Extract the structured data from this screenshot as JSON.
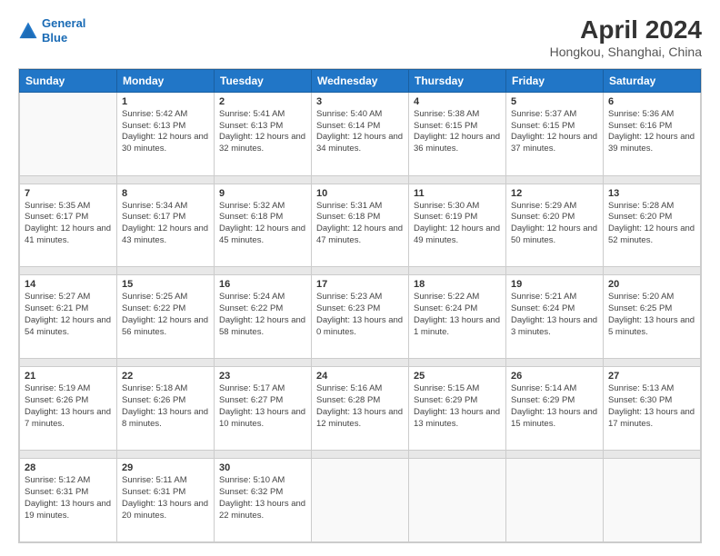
{
  "logo": {
    "line1": "General",
    "line2": "Blue"
  },
  "title": "April 2024",
  "subtitle": "Hongkou, Shanghai, China",
  "days_of_week": [
    "Sunday",
    "Monday",
    "Tuesday",
    "Wednesday",
    "Thursday",
    "Friday",
    "Saturday"
  ],
  "weeks": [
    [
      {
        "num": "",
        "sunrise": "",
        "sunset": "",
        "daylight": ""
      },
      {
        "num": "1",
        "sunrise": "Sunrise: 5:42 AM",
        "sunset": "Sunset: 6:13 PM",
        "daylight": "Daylight: 12 hours and 30 minutes."
      },
      {
        "num": "2",
        "sunrise": "Sunrise: 5:41 AM",
        "sunset": "Sunset: 6:13 PM",
        "daylight": "Daylight: 12 hours and 32 minutes."
      },
      {
        "num": "3",
        "sunrise": "Sunrise: 5:40 AM",
        "sunset": "Sunset: 6:14 PM",
        "daylight": "Daylight: 12 hours and 34 minutes."
      },
      {
        "num": "4",
        "sunrise": "Sunrise: 5:38 AM",
        "sunset": "Sunset: 6:15 PM",
        "daylight": "Daylight: 12 hours and 36 minutes."
      },
      {
        "num": "5",
        "sunrise": "Sunrise: 5:37 AM",
        "sunset": "Sunset: 6:15 PM",
        "daylight": "Daylight: 12 hours and 37 minutes."
      },
      {
        "num": "6",
        "sunrise": "Sunrise: 5:36 AM",
        "sunset": "Sunset: 6:16 PM",
        "daylight": "Daylight: 12 hours and 39 minutes."
      }
    ],
    [
      {
        "num": "7",
        "sunrise": "Sunrise: 5:35 AM",
        "sunset": "Sunset: 6:17 PM",
        "daylight": "Daylight: 12 hours and 41 minutes."
      },
      {
        "num": "8",
        "sunrise": "Sunrise: 5:34 AM",
        "sunset": "Sunset: 6:17 PM",
        "daylight": "Daylight: 12 hours and 43 minutes."
      },
      {
        "num": "9",
        "sunrise": "Sunrise: 5:32 AM",
        "sunset": "Sunset: 6:18 PM",
        "daylight": "Daylight: 12 hours and 45 minutes."
      },
      {
        "num": "10",
        "sunrise": "Sunrise: 5:31 AM",
        "sunset": "Sunset: 6:18 PM",
        "daylight": "Daylight: 12 hours and 47 minutes."
      },
      {
        "num": "11",
        "sunrise": "Sunrise: 5:30 AM",
        "sunset": "Sunset: 6:19 PM",
        "daylight": "Daylight: 12 hours and 49 minutes."
      },
      {
        "num": "12",
        "sunrise": "Sunrise: 5:29 AM",
        "sunset": "Sunset: 6:20 PM",
        "daylight": "Daylight: 12 hours and 50 minutes."
      },
      {
        "num": "13",
        "sunrise": "Sunrise: 5:28 AM",
        "sunset": "Sunset: 6:20 PM",
        "daylight": "Daylight: 12 hours and 52 minutes."
      }
    ],
    [
      {
        "num": "14",
        "sunrise": "Sunrise: 5:27 AM",
        "sunset": "Sunset: 6:21 PM",
        "daylight": "Daylight: 12 hours and 54 minutes."
      },
      {
        "num": "15",
        "sunrise": "Sunrise: 5:25 AM",
        "sunset": "Sunset: 6:22 PM",
        "daylight": "Daylight: 12 hours and 56 minutes."
      },
      {
        "num": "16",
        "sunrise": "Sunrise: 5:24 AM",
        "sunset": "Sunset: 6:22 PM",
        "daylight": "Daylight: 12 hours and 58 minutes."
      },
      {
        "num": "17",
        "sunrise": "Sunrise: 5:23 AM",
        "sunset": "Sunset: 6:23 PM",
        "daylight": "Daylight: 13 hours and 0 minutes."
      },
      {
        "num": "18",
        "sunrise": "Sunrise: 5:22 AM",
        "sunset": "Sunset: 6:24 PM",
        "daylight": "Daylight: 13 hours and 1 minute."
      },
      {
        "num": "19",
        "sunrise": "Sunrise: 5:21 AM",
        "sunset": "Sunset: 6:24 PM",
        "daylight": "Daylight: 13 hours and 3 minutes."
      },
      {
        "num": "20",
        "sunrise": "Sunrise: 5:20 AM",
        "sunset": "Sunset: 6:25 PM",
        "daylight": "Daylight: 13 hours and 5 minutes."
      }
    ],
    [
      {
        "num": "21",
        "sunrise": "Sunrise: 5:19 AM",
        "sunset": "Sunset: 6:26 PM",
        "daylight": "Daylight: 13 hours and 7 minutes."
      },
      {
        "num": "22",
        "sunrise": "Sunrise: 5:18 AM",
        "sunset": "Sunset: 6:26 PM",
        "daylight": "Daylight: 13 hours and 8 minutes."
      },
      {
        "num": "23",
        "sunrise": "Sunrise: 5:17 AM",
        "sunset": "Sunset: 6:27 PM",
        "daylight": "Daylight: 13 hours and 10 minutes."
      },
      {
        "num": "24",
        "sunrise": "Sunrise: 5:16 AM",
        "sunset": "Sunset: 6:28 PM",
        "daylight": "Daylight: 13 hours and 12 minutes."
      },
      {
        "num": "25",
        "sunrise": "Sunrise: 5:15 AM",
        "sunset": "Sunset: 6:29 PM",
        "daylight": "Daylight: 13 hours and 13 minutes."
      },
      {
        "num": "26",
        "sunrise": "Sunrise: 5:14 AM",
        "sunset": "Sunset: 6:29 PM",
        "daylight": "Daylight: 13 hours and 15 minutes."
      },
      {
        "num": "27",
        "sunrise": "Sunrise: 5:13 AM",
        "sunset": "Sunset: 6:30 PM",
        "daylight": "Daylight: 13 hours and 17 minutes."
      }
    ],
    [
      {
        "num": "28",
        "sunrise": "Sunrise: 5:12 AM",
        "sunset": "Sunset: 6:31 PM",
        "daylight": "Daylight: 13 hours and 19 minutes."
      },
      {
        "num": "29",
        "sunrise": "Sunrise: 5:11 AM",
        "sunset": "Sunset: 6:31 PM",
        "daylight": "Daylight: 13 hours and 20 minutes."
      },
      {
        "num": "30",
        "sunrise": "Sunrise: 5:10 AM",
        "sunset": "Sunset: 6:32 PM",
        "daylight": "Daylight: 13 hours and 22 minutes."
      },
      {
        "num": "",
        "sunrise": "",
        "sunset": "",
        "daylight": ""
      },
      {
        "num": "",
        "sunrise": "",
        "sunset": "",
        "daylight": ""
      },
      {
        "num": "",
        "sunrise": "",
        "sunset": "",
        "daylight": ""
      },
      {
        "num": "",
        "sunrise": "",
        "sunset": "",
        "daylight": ""
      }
    ]
  ]
}
